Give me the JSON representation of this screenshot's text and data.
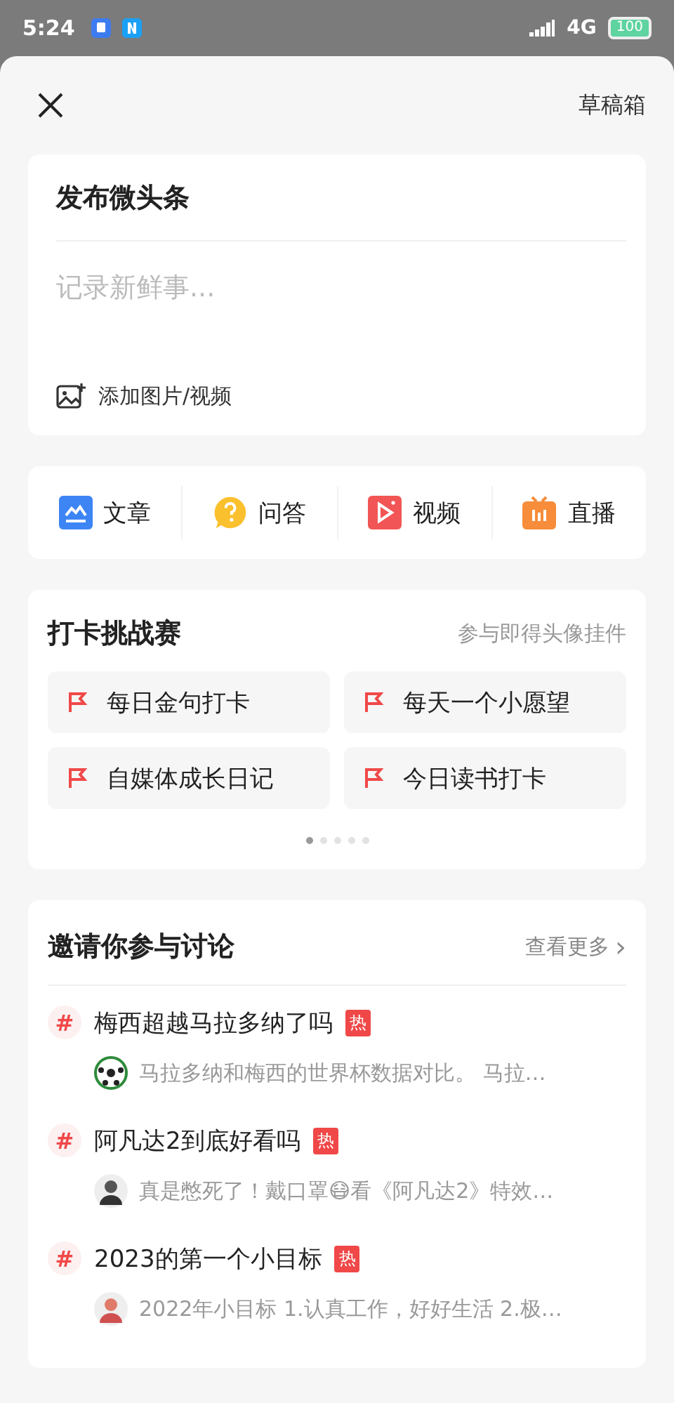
{
  "status_bar": {
    "time": "5:24",
    "network": "4G",
    "battery": "100"
  },
  "header": {
    "drafts": "草稿箱"
  },
  "composer": {
    "title": "发布微头条",
    "placeholder": "记录新鲜事...",
    "media": "添加图片/视频"
  },
  "actions": [
    {
      "kind": "article",
      "label": "文章"
    },
    {
      "kind": "qa",
      "label": "问答"
    },
    {
      "kind": "video",
      "label": "视频"
    },
    {
      "kind": "live",
      "label": "直播"
    }
  ],
  "challenge": {
    "title": "打卡挑战赛",
    "hint": "参与即得头像挂件",
    "items": [
      "每日金句打卡",
      "每天一个小愿望",
      "自媒体成长日记",
      "今日读书打卡"
    ],
    "pages": [
      {
        "selected": true
      },
      {
        "selected": false
      },
      {
        "selected": false
      },
      {
        "selected": false
      },
      {
        "selected": false
      }
    ]
  },
  "discussion": {
    "title": "邀请你参与讨论",
    "more": "查看更多",
    "more_icon": "›",
    "topics": [
      {
        "hash": "#",
        "title": "梅西超越马拉多纳了吗",
        "badge": "热",
        "excerpt": "马拉多纳和梅西的世界杯数据对比。 马拉…"
      },
      {
        "hash": "#",
        "title": "阿凡达2到底好看吗",
        "badge": "热",
        "excerpt": "真是憋死了！戴口罩😷看《阿凡达2》特效…"
      },
      {
        "hash": "#",
        "title": "2023的第一个小目标",
        "badge": "热",
        "excerpt": "2022年小目标 1.认真工作，好好生活 2.极…"
      }
    ]
  }
}
